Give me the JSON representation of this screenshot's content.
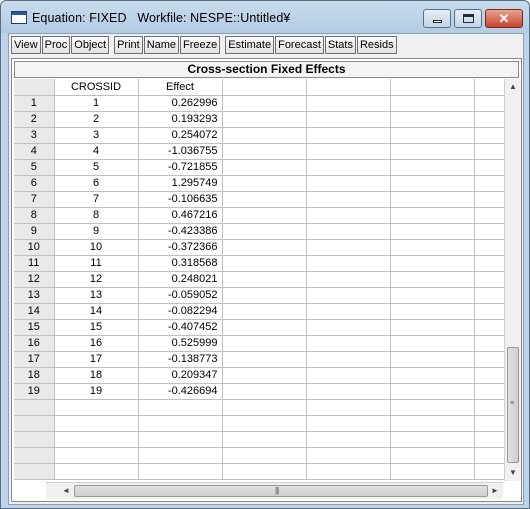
{
  "window": {
    "title": "Equation: FIXED   Workfile: NESPE::Untitled¥",
    "minimize_icon": "minimize-icon",
    "maximize_icon": "maximize-icon",
    "close_icon": "close-icon",
    "close_label": "✕"
  },
  "toolbar": {
    "buttons": [
      {
        "label": "View"
      },
      {
        "label": "Proc"
      },
      {
        "label": "Object"
      },
      {
        "label": "Print"
      },
      {
        "label": "Name"
      },
      {
        "label": "Freeze"
      },
      {
        "label": "Estimate"
      },
      {
        "label": "Forecast"
      },
      {
        "label": "Stats"
      },
      {
        "label": "Resids"
      }
    ]
  },
  "sheet": {
    "title": "Cross-section Fixed Effects",
    "columns": [
      "CROSSID",
      "Effect"
    ],
    "rows": [
      {
        "n": "1",
        "id": "1",
        "effect": "0.262996"
      },
      {
        "n": "2",
        "id": "2",
        "effect": "0.193293"
      },
      {
        "n": "3",
        "id": "3",
        "effect": "0.254072"
      },
      {
        "n": "4",
        "id": "4",
        "effect": "-1.036755"
      },
      {
        "n": "5",
        "id": "5",
        "effect": "-0.721855"
      },
      {
        "n": "6",
        "id": "6",
        "effect": "1.295749"
      },
      {
        "n": "7",
        "id": "7",
        "effect": "-0.106635"
      },
      {
        "n": "8",
        "id": "8",
        "effect": "0.467216"
      },
      {
        "n": "9",
        "id": "9",
        "effect": "-0.423386"
      },
      {
        "n": "10",
        "id": "10",
        "effect": "-0.372366"
      },
      {
        "n": "11",
        "id": "11",
        "effect": "0.318568"
      },
      {
        "n": "12",
        "id": "12",
        "effect": "0.248021"
      },
      {
        "n": "13",
        "id": "13",
        "effect": "-0.059052"
      },
      {
        "n": "14",
        "id": "14",
        "effect": "-0.082294"
      },
      {
        "n": "15",
        "id": "15",
        "effect": "-0.407452"
      },
      {
        "n": "16",
        "id": "16",
        "effect": "0.525999"
      },
      {
        "n": "17",
        "id": "17",
        "effect": "-0.138773"
      },
      {
        "n": "18",
        "id": "18",
        "effect": "0.209347"
      },
      {
        "n": "19",
        "id": "19",
        "effect": "-0.426694"
      }
    ],
    "empty_rows": 5
  },
  "scrollbars": {
    "up_arrow": "▲",
    "down_arrow": "▼",
    "left_arrow": "◄",
    "right_arrow": "►",
    "v_grip": "≡",
    "h_grip": "|||"
  }
}
